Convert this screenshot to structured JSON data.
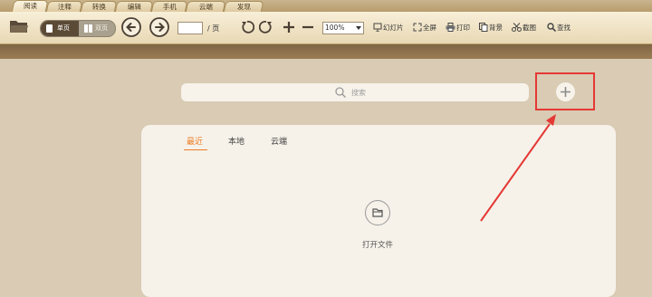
{
  "tabs": [
    "阅读",
    "注释",
    "转换",
    "编辑",
    "手机",
    "云端",
    "发现"
  ],
  "toolbar": {
    "single_page": "单页",
    "double_page": "双页",
    "page_value": "",
    "page_suffix": "/ 页",
    "zoom": "100%",
    "tools": [
      "幻灯片",
      "全屏",
      "打印",
      "背景",
      "截图",
      "查找"
    ]
  },
  "search": {
    "placeholder": "搜索"
  },
  "panel": {
    "tabs": [
      "最近",
      "本地",
      "云端"
    ],
    "active_tab": "最近",
    "open_file_label": "打开文件"
  },
  "colors": {
    "accent": "#ef7d25",
    "highlight_box": "#e53935"
  }
}
